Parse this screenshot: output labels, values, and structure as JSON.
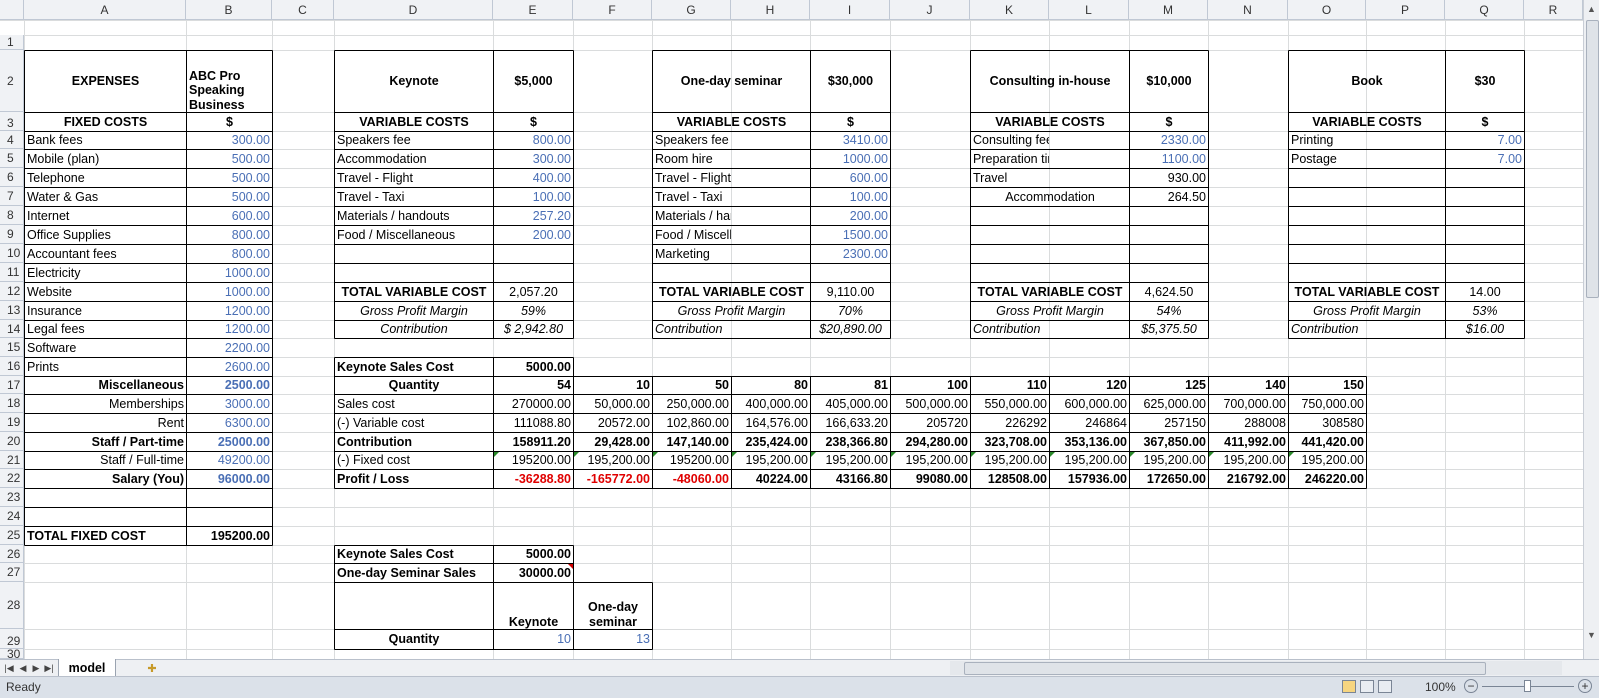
{
  "columns": [
    "A",
    "B",
    "C",
    "D",
    "E",
    "F",
    "G",
    "H",
    "I",
    "J",
    "K",
    "L",
    "M",
    "N",
    "O",
    "P",
    "Q",
    "R"
  ],
  "rows": [
    "1",
    "2",
    "3",
    "4",
    "5",
    "6",
    "7",
    "8",
    "9",
    "10",
    "11",
    "12",
    "13",
    "14",
    "15",
    "16",
    "17",
    "18",
    "19",
    "20",
    "21",
    "22",
    "23",
    "24",
    "25",
    "26",
    "27",
    "28",
    "29",
    "30"
  ],
  "cells": {
    "A3": "EXPENSES",
    "B3": "ABC Pro Speaking Business",
    "A4": "FIXED COSTS",
    "B4": "$",
    "A5": "Bank fees",
    "B5": "300.00",
    "A6": "Mobile (plan)",
    "B6": "500.00",
    "A7": "Telephone",
    "B7": "500.00",
    "A8": "Water & Gas",
    "B8": "500.00",
    "A9": "Internet",
    "B9": "600.00",
    "A10": "Office Supplies",
    "B10": "800.00",
    "A11": "Accountant fees",
    "B11": "800.00",
    "A12": "Electricity",
    "B12": "1000.00",
    "A13": "Website",
    "B13": "1000.00",
    "A14": "Insurance",
    "B14": "1200.00",
    "A15": "Legal fees",
    "B15": "1200.00",
    "A16": "Software",
    "B16": "2200.00",
    "A17": "Prints",
    "B17": "2600.00",
    "A18": "Miscellaneous",
    "B18": "2500.00",
    "A19": "Memberships",
    "B19": "3000.00",
    "A20": "Rent",
    "B20": "6300.00",
    "A21": "Staff / Part-time",
    "B21": "25000.00",
    "A22": "Staff / Full-time",
    "B22": "49200.00",
    "A23": "Salary (You)",
    "B23": "96000.00",
    "A26": "TOTAL FIXED COST",
    "B26": "195200.00",
    "D3": "Keynote",
    "E3": "$5,000",
    "D4": "VARIABLE COSTS",
    "E4": "$",
    "D5": "Speakers fee",
    "E5": "800.00",
    "D6": "Accommodation",
    "E6": "300.00",
    "D7": "Travel - Flight",
    "E7": "400.00",
    "D8": "Travel - Taxi",
    "E8": "100.00",
    "D9": "Materials / handouts",
    "E9": "257.20",
    "D10": "Food / Miscellaneous",
    "E10": "200.00",
    "D13": "TOTAL VARIABLE COST",
    "E13": "2,057.20",
    "D14": "Gross Profit Margin",
    "E14": "59%",
    "D15": "Contribution",
    "E15": "$  2,942.80",
    "G3": "One-day seminar",
    "I3": "$30,000",
    "G4": "VARIABLE COSTS",
    "I4": "$",
    "G5": "Speakers fee",
    "I5": "3410.00",
    "G6": "Room hire",
    "I6": "1000.00",
    "G7": "Travel - Flight",
    "I7": "600.00",
    "G8": "Travel - Taxi",
    "I8": "100.00",
    "G9": "Materials / handouts",
    "I9": "200.00",
    "G10": "Food / Miscellaneous",
    "I10": "1500.00",
    "G11": "Marketing",
    "I11": "2300.00",
    "G13": "TOTAL VARIABLE COST",
    "I13": "9,110.00",
    "G14": "Gross Profit Margin",
    "I14": "70%",
    "G15": "Contribution",
    "I15": "$20,890.00",
    "K3": "Consulting in-house",
    "M3": "$10,000",
    "K4": "VARIABLE COSTS",
    "M4": "$",
    "K5": "Consulting fees",
    "M5": "2330.00",
    "K6": "Preparation time",
    "M6": "1100.00",
    "K7": "Travel",
    "M7": "930.00",
    "K8": "Accommodation",
    "M8": "264.50",
    "K13": "TOTAL VARIABLE COST",
    "M13": "4,624.50",
    "K14": "Gross Profit Margin",
    "M14": "54%",
    "K15": "Contribution",
    "M15": "$5,375.50",
    "O3": "Book",
    "Q3": "$30",
    "O4": "VARIABLE COSTS",
    "Q4": "$",
    "O5": "Printing",
    "Q5": "7.00",
    "O6": "Postage",
    "Q6": "7.00",
    "O13": "TOTAL VARIABLE COST",
    "Q13": "14.00",
    "O14": "Gross Profit Margin",
    "Q14": "53%",
    "O15": "Contribution",
    "Q15": "$16.00",
    "D17": "Keynote Sales Cost",
    "E17": "5000.00",
    "D18": "Quantity",
    "E18": "54",
    "F18": "10",
    "G18": "50",
    "H18": "80",
    "I18": "81",
    "J18": "100",
    "K18": "110",
    "L18": "120",
    "M18": "125",
    "N18": "140",
    "O18": "150",
    "D19": "Sales cost",
    "E19": "270000.00",
    "F19": "50,000.00",
    "G19": "250,000.00",
    "H19": "400,000.00",
    "I19": "405,000.00",
    "J19": "500,000.00",
    "K19": "550,000.00",
    "L19": "600,000.00",
    "M19": "625,000.00",
    "N19": "700,000.00",
    "O19": "750,000.00",
    "D20": "(-) Variable cost",
    "E20": "111088.80",
    "F20": "20572.00",
    "G20": "102,860.00",
    "H20": "164,576.00",
    "I20": "166,633.20",
    "J20": "205720",
    "K20": "226292",
    "L20": "246864",
    "M20": "257150",
    "N20": "288008",
    "O20": "308580",
    "D21": "Contribution",
    "E21": "158911.20",
    "F21": "29,428.00",
    "G21": "147,140.00",
    "H21": "235,424.00",
    "I21": "238,366.80",
    "J21": "294,280.00",
    "K21": "323,708.00",
    "L21": "353,136.00",
    "M21": "367,850.00",
    "N21": "411,992.00",
    "O21": "441,420.00",
    "D22": "(-) Fixed cost",
    "E22": "195200.00",
    "F22": "195,200.00",
    "G22": "195200.00",
    "H22": "195,200.00",
    "I22": "195,200.00",
    "J22": "195,200.00",
    "K22": "195,200.00",
    "L22": "195,200.00",
    "M22": "195,200.00",
    "N22": "195,200.00",
    "O22": "195,200.00",
    "D23": "Profit / Loss",
    "E23": "-36288.80",
    "F23": "-165772.00",
    "G23": "-48060.00",
    "H23": "40224.00",
    "I23": "43166.80",
    "J23": "99080.00",
    "K23": "128508.00",
    "L23": "157936.00",
    "M23": "172650.00",
    "N23": "216792.00",
    "O23": "246220.00",
    "D27": "Keynote Sales Cost",
    "E27": "5000.00",
    "D28": "One-day Seminar Sales",
    "E28": "30000.00",
    "E29": "Keynote",
    "F29": "One-day seminar",
    "D30": "Quantity",
    "E30": "10",
    "F30": "13"
  },
  "sheet_tabs": [
    "model"
  ],
  "status": {
    "ready": "Ready",
    "zoom": "100%"
  }
}
